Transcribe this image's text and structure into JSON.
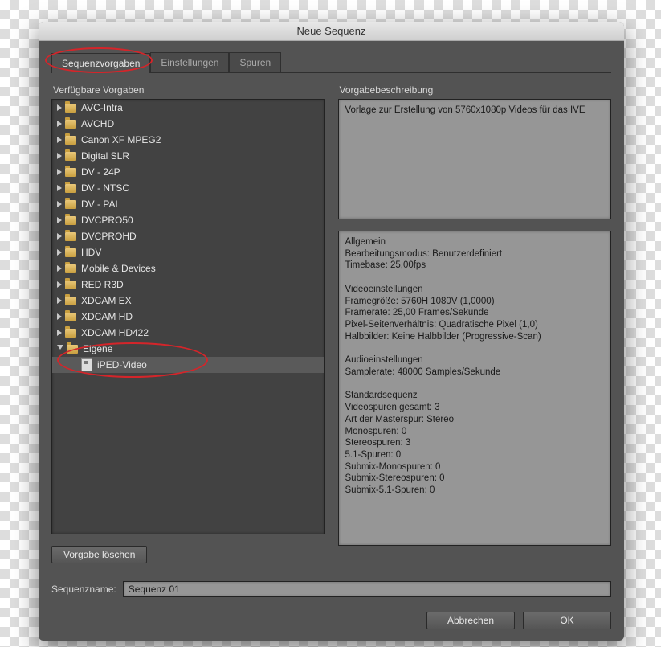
{
  "window": {
    "title": "Neue Sequenz"
  },
  "tabs": {
    "presets": "Sequenzvorgaben",
    "settings": "Einstellungen",
    "tracks": "Spuren"
  },
  "left_panel": {
    "label": "Verfügbare Vorgaben",
    "folders": [
      "AVC-Intra",
      "AVCHD",
      "Canon XF MPEG2",
      "Digital SLR",
      "DV - 24P",
      "DV - NTSC",
      "DV - PAL",
      "DVCPRO50",
      "DVCPROHD",
      "HDV",
      "Mobile & Devices",
      "RED R3D",
      "XDCAM EX",
      "XDCAM HD",
      "XDCAM HD422"
    ],
    "open_folder": "Eigene",
    "selected_preset": "iPED-Video",
    "delete_button": "Vorgabe löschen"
  },
  "right_panel": {
    "label": "Vorgabebeschreibung",
    "description": "Vorlage zur Erstellung von 5760x1080p Videos für das IVE",
    "details": "Allgemein\n Bearbeitungsmodus: Benutzerdefiniert\n Timebase: 25,00fps\n\nVideoeinstellungen\n Framegröße: 5760H 1080V (1,0000)\n Framerate: 25,00 Frames/Sekunde\n Pixel-Seitenverhältnis: Quadratische Pixel (1,0)\n Halbbilder: Keine Halbbilder (Progressive-Scan)\n\nAudioeinstellungen\n Samplerate: 48000 Samples/Sekunde\n\nStandardsequenz\n Videospuren gesamt: 3\n Art der Masterspur: Stereo\n Monospuren: 0\n Stereospuren: 3\n 5.1-Spuren: 0\n Submix-Monospuren: 0\n Submix-Stereospuren: 0\n Submix-5.1-Spuren: 0"
  },
  "sequence_name": {
    "label": "Sequenzname:",
    "value": "Sequenz 01"
  },
  "buttons": {
    "cancel": "Abbrechen",
    "ok": "OK"
  }
}
